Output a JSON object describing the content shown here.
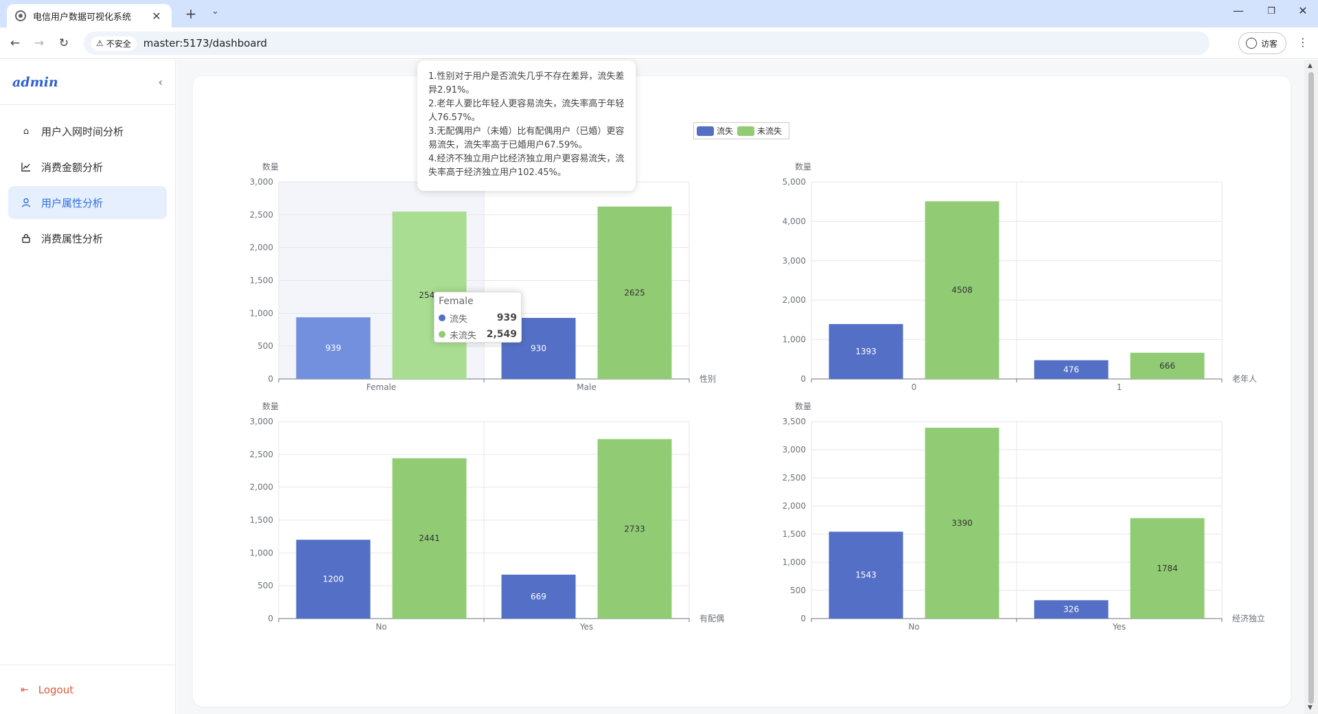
{
  "browser": {
    "tab_title": "电信用户数据可视化系统",
    "security_label": "不安全",
    "url": "master:5173/dashboard",
    "profile_label": "访客"
  },
  "sidebar": {
    "logo": "admin",
    "items": [
      {
        "label": "用户入网时间分析",
        "icon": "home-icon"
      },
      {
        "label": "消费金额分析",
        "icon": "line-chart-icon"
      },
      {
        "label": "用户属性分析",
        "icon": "user-icon"
      },
      {
        "label": "消费属性分析",
        "icon": "lock-icon"
      }
    ],
    "active_index": 2,
    "logout": "Logout"
  },
  "legend": {
    "items": [
      "流失",
      "未流失"
    ]
  },
  "info": {
    "lines": [
      "1.性别对于用户是否流失几乎不存在差异，流失差异2.91%。",
      "2.老年人要比年轻人更容易流失，流失率高于年轻人76.57%。",
      "3.无配偶用户（未婚）比有配偶用户（已婚）更容易流失，流失率高于已婚用户67.59%。",
      "4.经济不独立用户比经济独立用户更容易流失，流失率高于经济独立用户102.45%。"
    ]
  },
  "tooltip": {
    "title": "Female",
    "rows": [
      {
        "name": "流失",
        "value": "939"
      },
      {
        "name": "未流失",
        "value": "2,549"
      }
    ]
  },
  "colors": {
    "churn": "#5470c6",
    "retain": "#91cc75",
    "accent": "#2f6fde",
    "logout": "#e4573b"
  },
  "chart_data": [
    {
      "type": "bar",
      "categories": [
        "Female",
        "Male"
      ],
      "series": [
        {
          "name": "流失",
          "values": [
            939,
            930
          ]
        },
        {
          "name": "未流失",
          "values": [
            2549,
            2625
          ]
        }
      ],
      "xlabel": "性别",
      "ylabel": "数量",
      "ylim": [
        0,
        3000
      ],
      "yticks": [
        0,
        500,
        1000,
        1500,
        2000,
        2500,
        3000
      ],
      "hover_index": 0
    },
    {
      "type": "bar",
      "categories": [
        "0",
        "1"
      ],
      "series": [
        {
          "name": "流失",
          "values": [
            1393,
            476
          ]
        },
        {
          "name": "未流失",
          "values": [
            4508,
            666
          ]
        }
      ],
      "xlabel": "老年人",
      "ylabel": "数量",
      "ylim": [
        0,
        5000
      ],
      "yticks": [
        0,
        1000,
        2000,
        3000,
        4000,
        5000
      ]
    },
    {
      "type": "bar",
      "categories": [
        "No",
        "Yes"
      ],
      "series": [
        {
          "name": "流失",
          "values": [
            1200,
            669
          ]
        },
        {
          "name": "未流失",
          "values": [
            2441,
            2733
          ]
        }
      ],
      "xlabel": "有配偶",
      "ylabel": "数量",
      "ylim": [
        0,
        3000
      ],
      "yticks": [
        0,
        500,
        1000,
        1500,
        2000,
        2500,
        3000
      ]
    },
    {
      "type": "bar",
      "categories": [
        "No",
        "Yes"
      ],
      "series": [
        {
          "name": "流失",
          "values": [
            1543,
            326
          ]
        },
        {
          "name": "未流失",
          "values": [
            3390,
            1784
          ]
        }
      ],
      "xlabel": "经济独立",
      "ylabel": "数量",
      "ylim": [
        0,
        3500
      ],
      "yticks": [
        0,
        500,
        1000,
        1500,
        2000,
        2500,
        3000,
        3500
      ]
    }
  ]
}
